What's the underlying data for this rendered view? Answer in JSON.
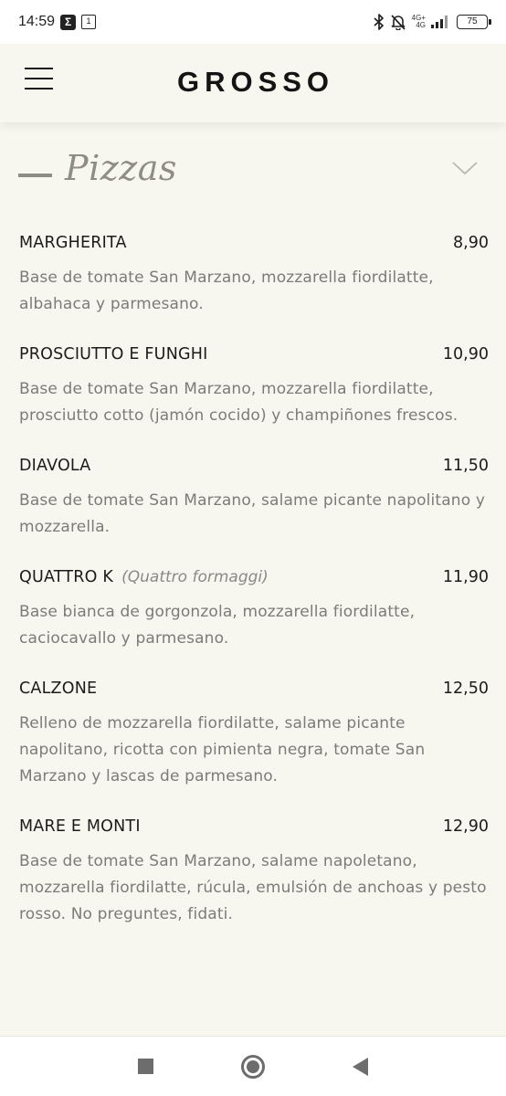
{
  "status_bar": {
    "time": "14:59",
    "notif_1": "Σ",
    "notif_2": "1",
    "network_top": "4G+",
    "network_bottom": "4G",
    "battery": "75"
  },
  "header": {
    "brand": "GROSSO"
  },
  "section": {
    "title": "Pizzas"
  },
  "menu": {
    "items": [
      {
        "name": "MARGHERITA",
        "subtitle": "",
        "price": "8,90",
        "description": "Base de tomate San Marzano, mozzarella fiordilatte, albahaca y parmesano."
      },
      {
        "name": "PROSCIUTTO E FUNGHI",
        "subtitle": "",
        "price": "10,90",
        "description": "Base de tomate San Marzano, mozzarella fiordilatte, prosciutto cotto (jamón cocido) y champiñones frescos."
      },
      {
        "name": "DIAVOLA",
        "subtitle": "",
        "price": "11,50",
        "description": "Base de tomate San Marzano, salame picante napolitano y mozzarella."
      },
      {
        "name": "QUATTRO K",
        "subtitle": "(Quattro formaggi)",
        "price": "11,90",
        "description": "Base bianca de gorgonzola, mozzarella fiordilatte, caciocavallo y parmesano."
      },
      {
        "name": "CALZONE",
        "subtitle": "",
        "price": "12,50",
        "description": "Relleno de mozzarella fiordilatte, salame picante napolitano, ricotta con pimienta negra, tomate San Marzano y lascas de parmesano."
      },
      {
        "name": "MARE E MONTI",
        "subtitle": "",
        "price": "12,90",
        "description": "Base de tomate San Marzano, salame napoletano, mozzarella fiordilatte, rúcula, emulsión de anchoas y pesto rosso. No preguntes, fidati."
      }
    ]
  },
  "icons": {
    "menu": "hamburger-menu-icon",
    "expand": "chevron-down-icon",
    "bluetooth": "bluetooth-icon",
    "mute": "bell-off-icon"
  },
  "colors": {
    "background": "#f8f7ef",
    "muted_text": "#7c7b76",
    "section_gray": "#8e8c85"
  }
}
